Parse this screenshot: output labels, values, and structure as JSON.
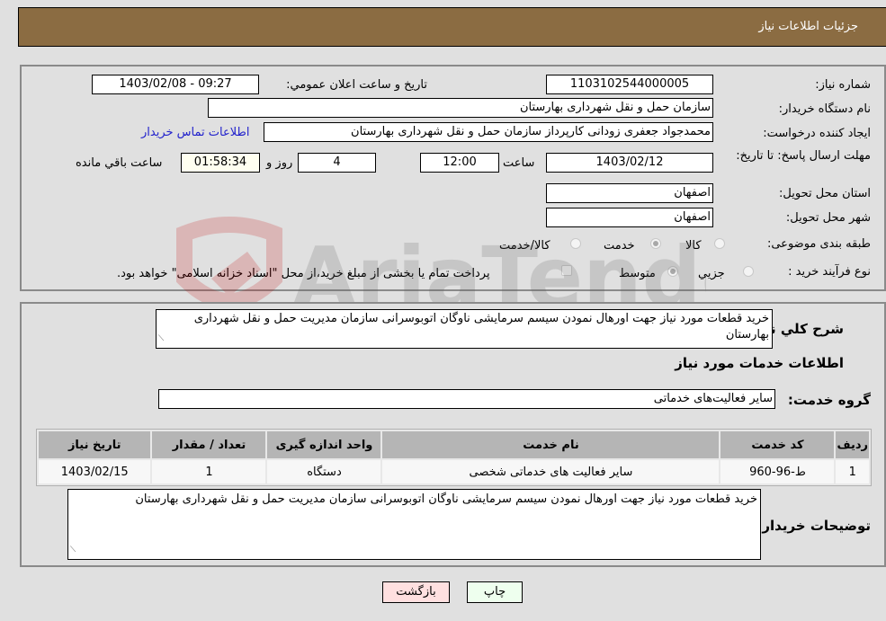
{
  "header": {
    "title": "جزئیات اطلاعات نیاز"
  },
  "form": {
    "need_number": {
      "label": "شماره نیاز:",
      "value": "1103102544000005"
    },
    "announce_datetime": {
      "label": "تاریخ و ساعت اعلان عمومي:",
      "value": "1403/02/08 - 09:27"
    },
    "buyer_org": {
      "label": "نام دستگاه خریدار:",
      "value": "سازمان حمل و نقل شهرداری بهارستان"
    },
    "requester": {
      "label": "ایجاد کننده درخواست:",
      "value": "محمدجواد جعفری زودانی کارپرداز سازمان حمل و نقل شهرداری بهارستان",
      "contact_link": "اطلاعات تماس خریدار"
    },
    "deadline": {
      "label": "مهلت ارسال پاسخ: تا تاریخ:",
      "date": "1403/02/12",
      "time_label": "ساعت",
      "time": "12:00",
      "days": "4",
      "days_label": "روز و",
      "remaining": "01:58:34",
      "remaining_label": "ساعت باقي مانده"
    },
    "province": {
      "label": "استان محل تحویل:",
      "value": "اصفهان"
    },
    "city": {
      "label": "شهر محل تحویل:",
      "value": "اصفهان"
    },
    "category": {
      "label": "طبقه بندی موضوعی:",
      "options": [
        "کالا",
        "خدمت",
        "کالا/خدمت"
      ],
      "selected": "خدمت"
    },
    "purchase_type": {
      "label": "نوع فرآیند خرید :",
      "options": [
        "جزيي",
        "متوسط"
      ],
      "selected": "متوسط",
      "payment_note": "پرداخت تمام یا بخشی از مبلغ خرید،از محل \"اسناد خزانه اسلامی\" خواهد بود."
    }
  },
  "summary": {
    "label": "شرح کلي نیاز:",
    "value": "خرید قطعات مورد نیاز جهت اورهال نمودن سیسم سرمایشی ناوگان اتوبوسرانی سازمان مدیریت حمل و نقل شهرداری بهارستان"
  },
  "services": {
    "section_title": "اطلاعات خدمات مورد نیاز",
    "group_label": "گروه خدمت:",
    "group_value": "سایر فعالیت‌های خدماتی",
    "columns": [
      "ردیف",
      "کد خدمت",
      "نام خدمت",
      "واحد اندازه گیری",
      "تعداد / مقدار",
      "تاریخ نیاز"
    ],
    "rows": [
      [
        "1",
        "ط-96-960",
        "سایر فعالیت های خدماتی شخصی",
        "دستگاه",
        "1",
        "1403/02/15"
      ]
    ]
  },
  "buyer_notes": {
    "label": "توضیحات خریدار:",
    "value": "خرید قطعات مورد نیاز جهت اورهال نمودن سیسم سرمایشی ناوگان اتوبوسرانی سازمان مدیریت حمل و نقل شهرداری بهارستان"
  },
  "buttons": {
    "print": "چاپ",
    "back": "بازگشت"
  },
  "watermark": {
    "text": "AriaTender.neT"
  },
  "colors": {
    "header_bg": "#8b6c42",
    "print_bg": "#eeffee",
    "back_bg": "#ffe0e0",
    "link": "#2222cc"
  }
}
